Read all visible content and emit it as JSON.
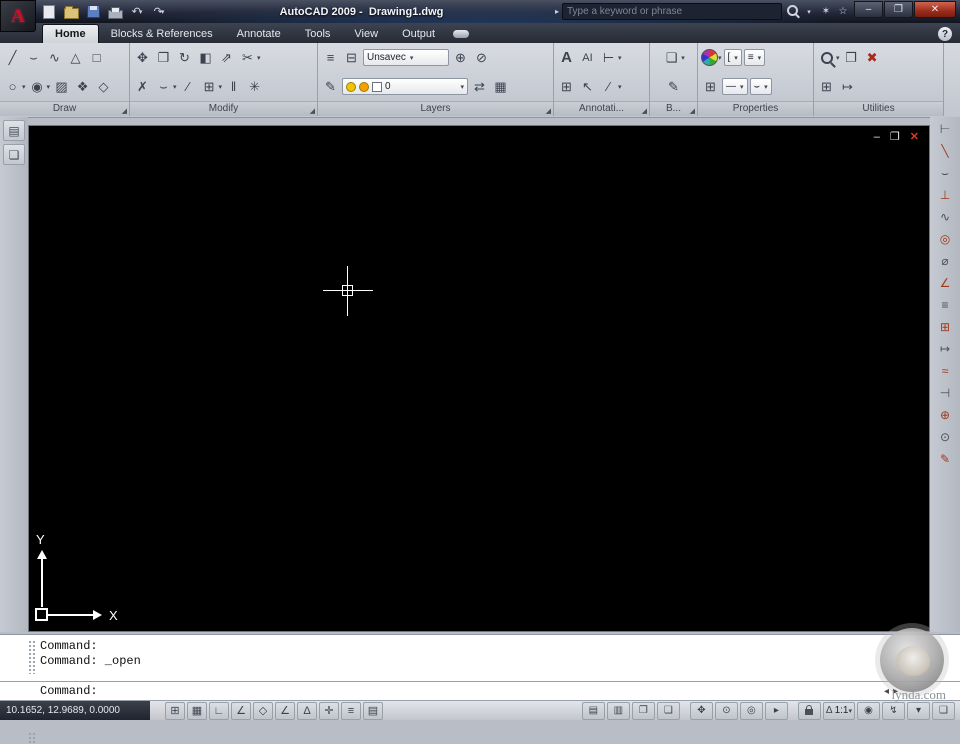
{
  "titlebar": {
    "title": "AutoCAD 2009 -  Drawing1.dwg",
    "search_placeholder": "Type a keyword or phrase"
  },
  "logo_letter": "A",
  "tabs": [
    {
      "label": "Home",
      "active": true
    },
    {
      "label": "Blocks & References",
      "active": false
    },
    {
      "label": "Annotate",
      "active": false
    },
    {
      "label": "Tools",
      "active": false
    },
    {
      "label": "View",
      "active": false
    },
    {
      "label": "Output",
      "active": false
    }
  ],
  "help_label": "?",
  "window_controls": {
    "minimize": "–",
    "maximize": "❐",
    "close": "✕"
  },
  "canvas_controls": {
    "minimize": "–",
    "restore": "❐",
    "close": "✕"
  },
  "ribbon": {
    "panel_labels": {
      "draw": "Draw",
      "modify": "Modify",
      "layers": "Layers",
      "annotation": "Annotati...",
      "block": "B...",
      "properties": "Properties",
      "utilities": "Utilities"
    },
    "layer_state": "Unsavec",
    "current_layer": "0",
    "icons": {
      "draw1": [
        "╱",
        "⌣",
        "∿",
        "△",
        "□"
      ],
      "draw2": [
        "○",
        "◉",
        "▨",
        "❖",
        "◇"
      ],
      "modify1": [
        "✥",
        "❐",
        "↻",
        "◧",
        "⇗",
        "✂"
      ],
      "modify2": [
        "✗",
        "⌣",
        "∕",
        "⊞",
        "‖",
        "✳"
      ],
      "layers1": [
        "≡",
        "⊟",
        "⊕",
        "⊘"
      ],
      "layers2": [
        "✎",
        "⇄",
        "▦"
      ],
      "annotation1": [
        "A",
        "AI",
        "⊢"
      ],
      "annotation2": [
        "⊞",
        "↖",
        "∕"
      ],
      "block": [
        "❑",
        "✎"
      ],
      "properties1": [
        "[",
        "≡"
      ],
      "properties2": [
        "⊞",
        "—",
        "⌣"
      ],
      "utilities1": [
        "❐",
        "✖"
      ],
      "utilities2": [
        "⊞",
        "↦"
      ]
    }
  },
  "ucs": {
    "x": "X",
    "y": "Y"
  },
  "right_toolbar": [
    {
      "name": "dim-linear",
      "glyph": "⊢"
    },
    {
      "name": "dim-aligned",
      "glyph": "╲"
    },
    {
      "name": "dim-arc-length",
      "glyph": "⌣"
    },
    {
      "name": "dim-ordinate",
      "glyph": "⊥"
    },
    {
      "name": "dim-jogged",
      "glyph": "∿"
    },
    {
      "name": "dim-radius",
      "glyph": "◎"
    },
    {
      "name": "dim-diameter",
      "glyph": "⌀"
    },
    {
      "name": "dim-angular",
      "glyph": "∠"
    },
    {
      "name": "quick-dim",
      "glyph": "≡"
    },
    {
      "name": "dim-baseline",
      "glyph": "⊞"
    },
    {
      "name": "dim-continue",
      "glyph": "↦"
    },
    {
      "name": "dim-spacing",
      "glyph": "≈"
    },
    {
      "name": "dim-break",
      "glyph": "⊣"
    },
    {
      "name": "tolerance",
      "glyph": "⊕"
    },
    {
      "name": "center-mark",
      "glyph": "⊙"
    },
    {
      "name": "dim-edit",
      "glyph": "✎"
    }
  ],
  "command": {
    "history": [
      "Command:",
      "Command: _open"
    ],
    "prompt": "Command:"
  },
  "statusbar": {
    "coordinates": "10.1652, 12.9689, 0.0000",
    "annotation_scale": "1:1",
    "toggles": [
      {
        "name": "snap",
        "glyph": "⊞"
      },
      {
        "name": "grid",
        "glyph": "▦"
      },
      {
        "name": "ortho",
        "glyph": "∟"
      },
      {
        "name": "polar",
        "glyph": "∠"
      },
      {
        "name": "osnap",
        "glyph": "◇"
      },
      {
        "name": "otrack",
        "glyph": "∠"
      },
      {
        "name": "ducs",
        "glyph": "Δ"
      },
      {
        "name": "dyn",
        "glyph": "✛"
      },
      {
        "name": "lwt",
        "glyph": "≡"
      },
      {
        "name": "qp",
        "glyph": "▤"
      }
    ],
    "right_icons": [
      {
        "name": "model",
        "glyph": "▤"
      },
      {
        "name": "layout",
        "glyph": "▥"
      },
      {
        "name": "quick-view-drawings",
        "glyph": "❐"
      },
      {
        "name": "quick-view-layouts",
        "glyph": "❏"
      },
      {
        "name": "pan",
        "glyph": "✥"
      },
      {
        "name": "zoom",
        "glyph": "⊙"
      },
      {
        "name": "steering-wheel",
        "glyph": "◎"
      },
      {
        "name": "show-motion",
        "glyph": "▸"
      },
      {
        "name": "annotation-scale",
        "glyph": "Δ"
      },
      {
        "name": "annotation-visibility",
        "glyph": "◉"
      },
      {
        "name": "auto-scale",
        "glyph": "↯"
      },
      {
        "name": "status-menu",
        "glyph": "▾"
      },
      {
        "name": "clean-screen",
        "glyph": "❏"
      }
    ]
  },
  "watermark": {
    "text": "lynda.com"
  },
  "colors": {
    "accent_red": "#c8102e",
    "canvas": "#000000",
    "ribbon": "#c9cdd6"
  }
}
